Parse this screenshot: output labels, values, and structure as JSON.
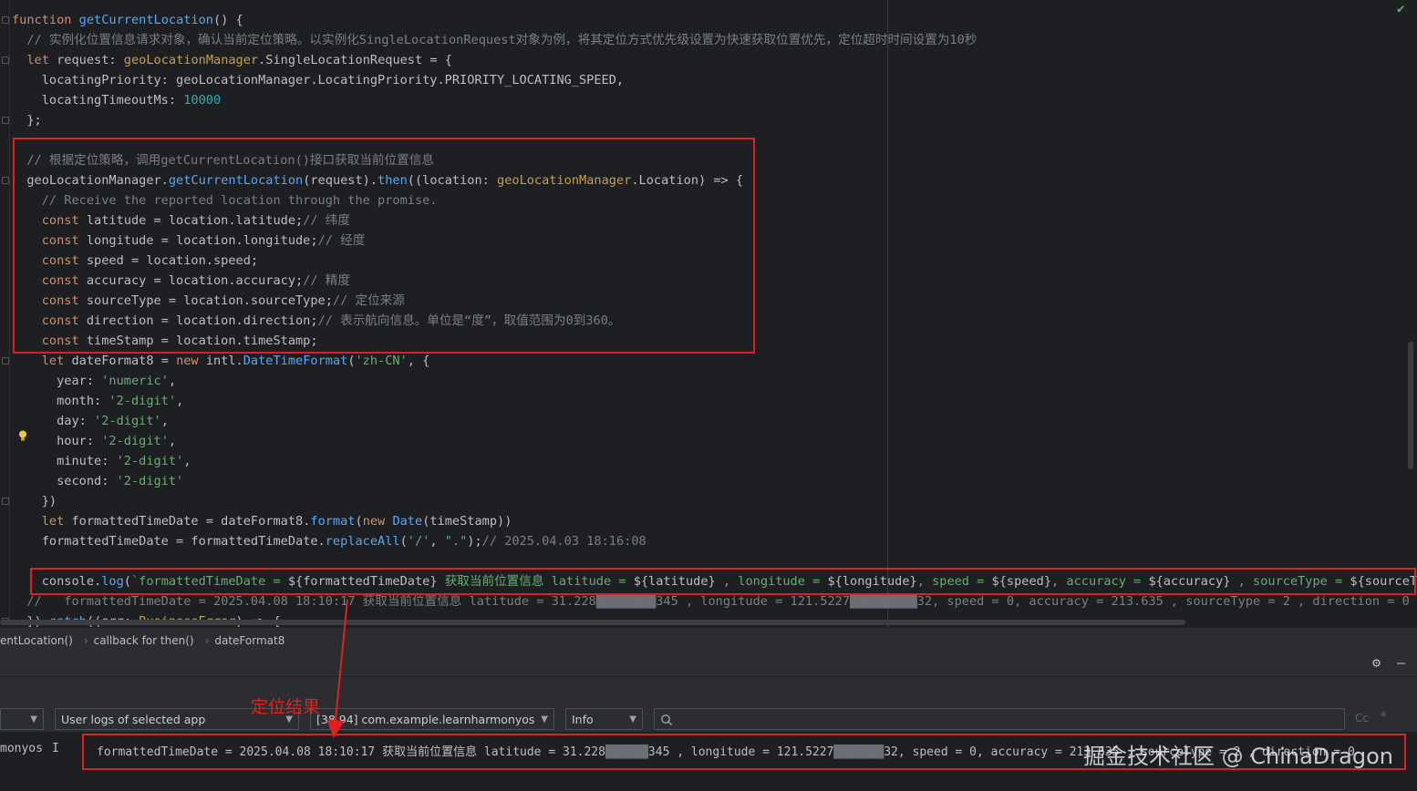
{
  "editor": {
    "lines": [
      [
        [
          "kw",
          "function "
        ],
        [
          "fn",
          "getCurrentLocation"
        ],
        [
          "p",
          "() {"
        ]
      ],
      [
        [
          "cm",
          "  // 实例化位置信息请求对象，确认当前定位策略。以实例化SingleLocationRequest对象为例，将其定位方式优先级设置为快速获取位置优先，定位超时时间设置为10秒"
        ]
      ],
      [
        [
          "p",
          "  "
        ],
        [
          "kw",
          "let "
        ],
        [
          "p",
          "request: "
        ],
        [
          "tp",
          "geoLocationManager"
        ],
        [
          "p",
          ".SingleLocationRequest = {"
        ]
      ],
      [
        [
          "p",
          "    locatingPriority: geoLocationManager.LocatingPriority.PRIORITY_LOCATING_SPEED,"
        ]
      ],
      [
        [
          "p",
          "    locatingTimeoutMs: "
        ],
        [
          "num",
          "10000"
        ]
      ],
      [
        [
          "p",
          "  };"
        ]
      ],
      [
        [
          "p",
          ""
        ]
      ],
      [
        [
          "cm",
          "  // 根据定位策略，调用getCurrentLocation()接口获取当前位置信息"
        ]
      ],
      [
        [
          "p",
          "  geoLocationManager."
        ],
        [
          "fn",
          "getCurrentLocation"
        ],
        [
          "p",
          "(request)."
        ],
        [
          "fn",
          "then"
        ],
        [
          "p",
          "((location: "
        ],
        [
          "tp",
          "geoLocationManager"
        ],
        [
          "p",
          ".Location) => {"
        ]
      ],
      [
        [
          "cm",
          "    // Receive the reported location through the promise."
        ]
      ],
      [
        [
          "kw",
          "    const "
        ],
        [
          "p",
          "latitude = location.latitude;"
        ],
        [
          "cm",
          "// 纬度"
        ]
      ],
      [
        [
          "kw",
          "    const "
        ],
        [
          "p",
          "longitude = location.longitude;"
        ],
        [
          "cm",
          "// 经度"
        ]
      ],
      [
        [
          "kw",
          "    const "
        ],
        [
          "p",
          "speed = location.speed;"
        ]
      ],
      [
        [
          "kw",
          "    const "
        ],
        [
          "p",
          "accuracy = location.accuracy;"
        ],
        [
          "cm",
          "// 精度"
        ]
      ],
      [
        [
          "kw",
          "    const "
        ],
        [
          "p",
          "sourceType = location.sourceType;"
        ],
        [
          "cm",
          "// 定位来源"
        ]
      ],
      [
        [
          "kw",
          "    const "
        ],
        [
          "p",
          "direction = location.direction;"
        ],
        [
          "cm",
          "// 表示航向信息。单位是“度”，取值范围为0到360。"
        ]
      ],
      [
        [
          "kw",
          "    const "
        ],
        [
          "p",
          "timeStamp = location.timeStamp;"
        ]
      ],
      [
        [
          "kw",
          "    let "
        ],
        [
          "p",
          "dateFormat8 = "
        ],
        [
          "kw",
          "new "
        ],
        [
          "p",
          "intl."
        ],
        [
          "fn",
          "DateTimeFormat"
        ],
        [
          "p",
          "("
        ],
        [
          "str",
          "'zh-CN'"
        ],
        [
          "p",
          ", {"
        ]
      ],
      [
        [
          "p",
          "      year: "
        ],
        [
          "str",
          "'numeric'"
        ],
        [
          "p",
          ","
        ]
      ],
      [
        [
          "p",
          "      month: "
        ],
        [
          "str",
          "'2-digit'"
        ],
        [
          "p",
          ","
        ]
      ],
      [
        [
          "p",
          "      day: "
        ],
        [
          "str",
          "'2-digit'"
        ],
        [
          "p",
          ","
        ]
      ],
      [
        [
          "p",
          "      hour: "
        ],
        [
          "str",
          "'2-digit'"
        ],
        [
          "p",
          ","
        ]
      ],
      [
        [
          "p",
          "      minute: "
        ],
        [
          "str",
          "'2-digit'"
        ],
        [
          "p",
          ","
        ]
      ],
      [
        [
          "p",
          "      second: "
        ],
        [
          "str",
          "'2-digit'"
        ]
      ],
      [
        [
          "p",
          "    })"
        ]
      ],
      [
        [
          "kw",
          "    let "
        ],
        [
          "p",
          "formattedTimeDate = dateFormat8."
        ],
        [
          "fn",
          "format"
        ],
        [
          "p",
          "("
        ],
        [
          "kw",
          "new "
        ],
        [
          "fn",
          "Date"
        ],
        [
          "p",
          "(timeStamp))"
        ]
      ],
      [
        [
          "p",
          "    formattedTimeDate = formattedTimeDate."
        ],
        [
          "fn",
          "replaceAll"
        ],
        [
          "p",
          "("
        ],
        [
          "str",
          "'/'"
        ],
        [
          "p",
          ", "
        ],
        [
          "str",
          "\".\""
        ],
        [
          "p",
          ");"
        ],
        [
          "cm",
          "// 2025.04.03 18:16:08"
        ]
      ],
      [
        [
          "p",
          ""
        ]
      ],
      [
        [
          "p",
          "    console."
        ],
        [
          "fn",
          "log"
        ],
        [
          "p",
          "("
        ],
        [
          "str",
          "`formattedTimeDate = "
        ],
        [
          "p",
          "${formattedTimeDate}"
        ],
        [
          "str",
          " 获取当前位置信息 latitude = "
        ],
        [
          "p",
          "${latitude}"
        ],
        [
          "str",
          " , longitude = "
        ],
        [
          "p",
          "${longitude}"
        ],
        [
          "str",
          ", speed = "
        ],
        [
          "p",
          "${speed}"
        ],
        [
          "str",
          ", accuracy = "
        ],
        [
          "p",
          "${accuracy}"
        ],
        [
          "str",
          " , sourceType = "
        ],
        [
          "p",
          "${sourceType}"
        ]
      ],
      [
        [
          "cm",
          "  //   formattedTimeDate = 2025.04.08 18:10:17 获取当前位置信息 latitude = 31.228"
        ],
        [
          "blur",
          "████████"
        ],
        [
          "cm",
          "345 , longitude = 121.5227"
        ],
        [
          "blur",
          "█████████"
        ],
        [
          "cm",
          "32, speed = 0, accuracy = 213.635 , sourceType = 2 , direction = 0"
        ]
      ],
      [
        [
          "p",
          "  })."
        ],
        [
          "fn",
          "catch"
        ],
        [
          "p",
          "((err: "
        ],
        [
          "tp",
          "BusinessError"
        ],
        [
          "p",
          ") => {"
        ]
      ]
    ]
  },
  "breadcrumb": [
    "entLocation()",
    "callback for then()",
    "dateFormat8"
  ],
  "filters": {
    "left_stub": "",
    "log_source": "User logs of selected app",
    "process": "[38  94] com.example.learnharmonyos",
    "level": "Info",
    "search_placeholder": "",
    "cc_label": "Cc",
    "star_label": "*"
  },
  "annotation": "定位结果",
  "log": {
    "tag": "monyos",
    "level": "I",
    "message": "formattedTimeDate = 2025.04.08 18:10:17 获取当前位置信息 latitude = 31.228",
    "message_mid": "345 , longitude = 121.5227",
    "message_tail": "32, speed = 0, accuracy = 213.635 , sourceType = 2 , direction = 0"
  },
  "watermark": "掘金技术社区 @ ChinaDragon",
  "colors": {
    "editor_bg": "#1e1f22",
    "panel_bg": "#2b2d30",
    "highlight_box": "#e02020",
    "keyword": "#cf8e6d",
    "function": "#56a8f5",
    "string": "#6aab73",
    "comment": "#7a7e85"
  }
}
